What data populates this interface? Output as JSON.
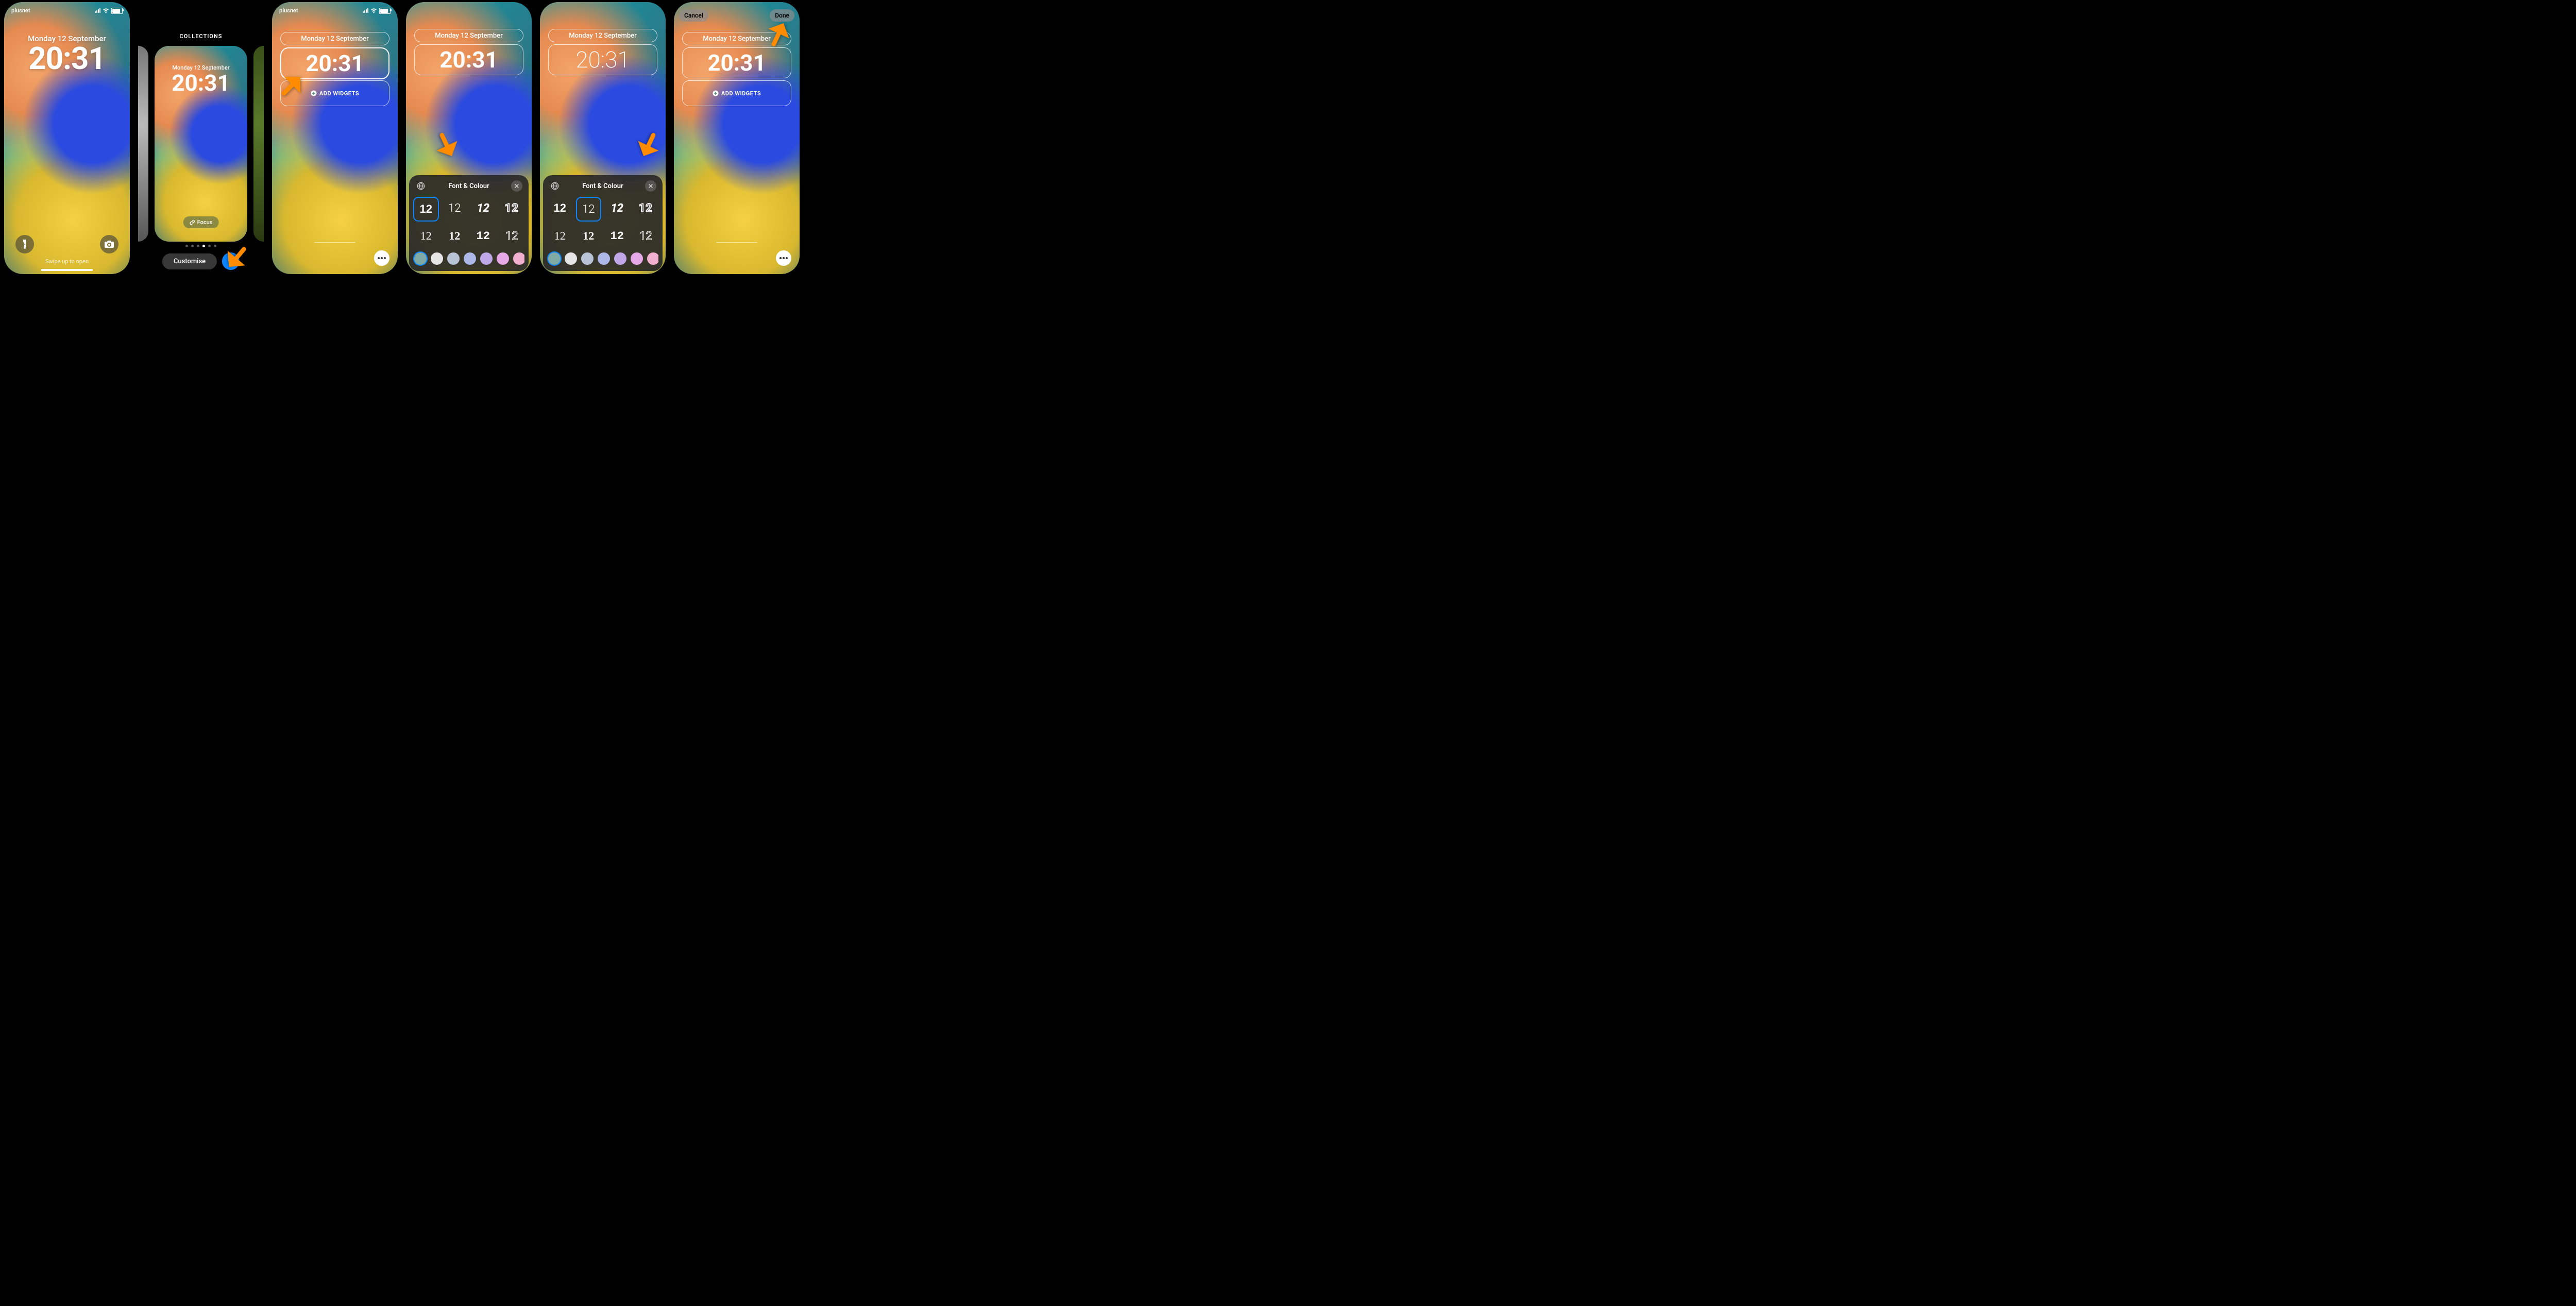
{
  "status": {
    "carrier": "plusnet"
  },
  "lock": {
    "date": "Monday 12 September",
    "time": "20:31",
    "swipe_hint": "Swipe up to open"
  },
  "collections": {
    "label": "COLLECTIONS",
    "date": "Monday 12 September",
    "time": "20:31",
    "focus_label": "Focus",
    "customise_label": "Customise",
    "add_symbol": "+"
  },
  "edit": {
    "date": "Monday 12 September",
    "time": "20:31",
    "add_widgets_label": "ADD WIDGETS",
    "cancel_label": "Cancel",
    "done_label": "Done"
  },
  "sheet": {
    "title": "Font & Colour",
    "fonts": [
      "12",
      "12",
      "12",
      "12",
      "12",
      "12",
      "12",
      "12"
    ],
    "colors": [
      "#7ea9a4",
      "#e5e5e5",
      "#b9c3d6",
      "#adb8e8",
      "#c0a8e8",
      "#e6a8e6",
      "#f2b0d0"
    ],
    "selected_font_screen4": 0,
    "selected_font_screen5": 1,
    "selected_color": 0
  }
}
